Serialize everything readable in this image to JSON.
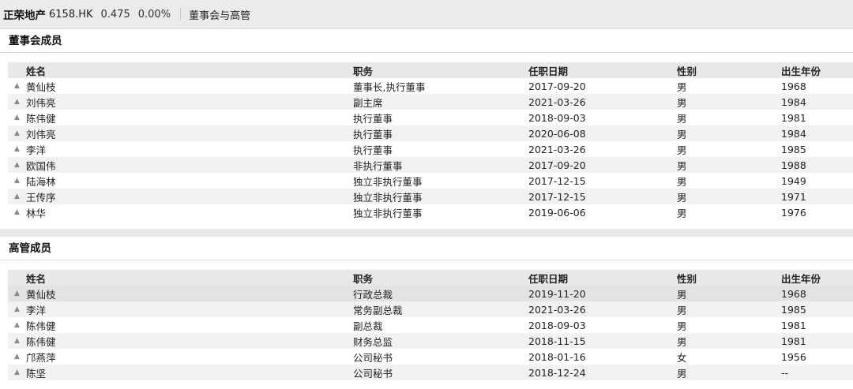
{
  "header": {
    "company": "正荣地产",
    "code": "6158.HK",
    "price": "0.475",
    "change": "0.00%",
    "crumb": "董事会与高管"
  },
  "columns": [
    "姓名",
    "职务",
    "任职日期",
    "性别",
    "出生年份"
  ],
  "expand_icon": "▲",
  "board": {
    "title": "董事会成员",
    "rows": [
      {
        "name": "黄仙枝",
        "role": "董事长,执行董事",
        "date": "2017-09-20",
        "gender": "男",
        "birth": "1968"
      },
      {
        "name": "刘伟亮",
        "role": "副主席",
        "date": "2021-03-26",
        "gender": "男",
        "birth": "1984"
      },
      {
        "name": "陈伟健",
        "role": "执行董事",
        "date": "2018-09-03",
        "gender": "男",
        "birth": "1981"
      },
      {
        "name": "刘伟亮",
        "role": "执行董事",
        "date": "2020-06-08",
        "gender": "男",
        "birth": "1984"
      },
      {
        "name": "李洋",
        "role": "执行董事",
        "date": "2021-03-26",
        "gender": "男",
        "birth": "1985"
      },
      {
        "name": "欧国伟",
        "role": "非执行董事",
        "date": "2017-09-20",
        "gender": "男",
        "birth": "1988"
      },
      {
        "name": "陆海林",
        "role": "独立非执行董事",
        "date": "2017-12-15",
        "gender": "男",
        "birth": "1949"
      },
      {
        "name": "王传序",
        "role": "独立非执行董事",
        "date": "2017-12-15",
        "gender": "男",
        "birth": "1971"
      },
      {
        "name": "林华",
        "role": "独立非执行董事",
        "date": "2019-06-06",
        "gender": "男",
        "birth": "1976"
      }
    ]
  },
  "executives": {
    "title": "高管成员",
    "rows": [
      {
        "name": "黄仙枝",
        "role": "行政总裁",
        "date": "2019-11-20",
        "gender": "男",
        "birth": "1968"
      },
      {
        "name": "李洋",
        "role": "常务副总裁",
        "date": "2021-03-26",
        "gender": "男",
        "birth": "1985"
      },
      {
        "name": "陈伟健",
        "role": "副总裁",
        "date": "2018-09-03",
        "gender": "男",
        "birth": "1981"
      },
      {
        "name": "陈伟健",
        "role": "财务总监",
        "date": "2018-11-15",
        "gender": "男",
        "birth": "1981"
      },
      {
        "name": "邝燕萍",
        "role": "公司秘书",
        "date": "2018-01-16",
        "gender": "女",
        "birth": "1956"
      },
      {
        "name": "陈坚",
        "role": "公司秘书",
        "date": "2018-12-24",
        "gender": "男",
        "birth": "--"
      }
    ]
  }
}
